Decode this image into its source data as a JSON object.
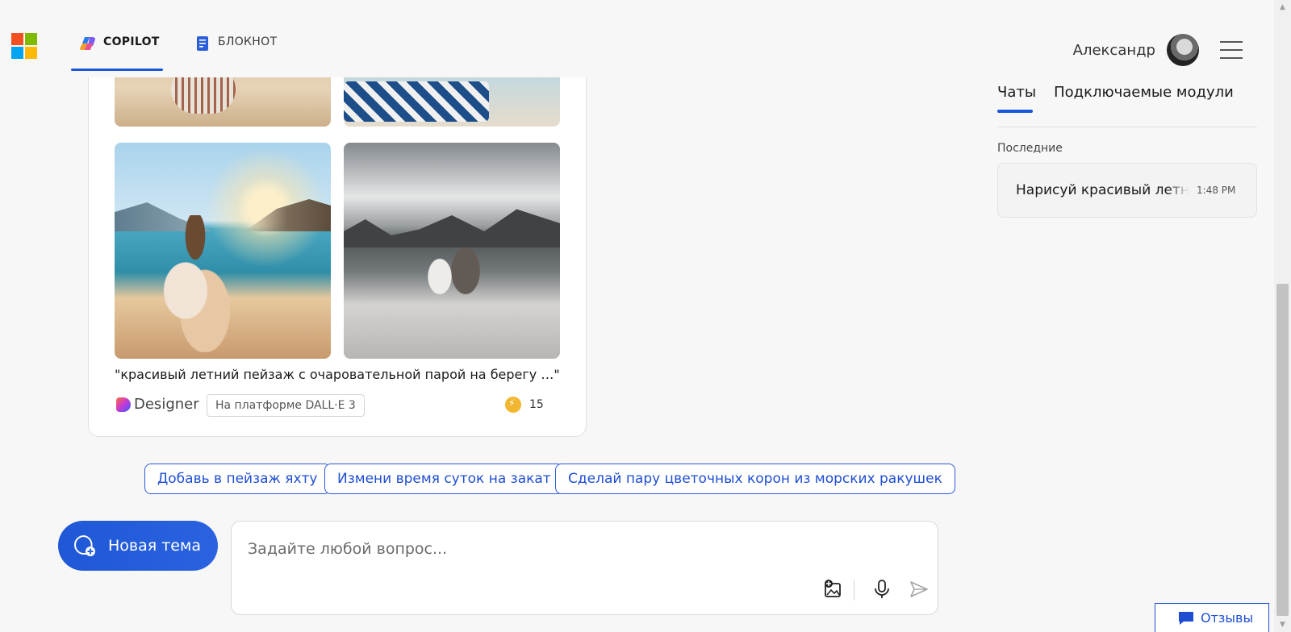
{
  "header": {
    "tabs": [
      {
        "label": "COPILOT",
        "icon": "copilot-icon",
        "active": true
      },
      {
        "label": "БЛОКНОТ",
        "icon": "notebook-icon",
        "active": false
      }
    ],
    "user_name": "Александр",
    "brand_colors": {
      "red": "#f25022",
      "green": "#7fba00",
      "blue": "#00a4ef",
      "yellow": "#ffb900"
    }
  },
  "result_card": {
    "caption": "\"красивый летний пейзаж с очаровательной парой на берегу …\"",
    "designer_label": "Designer",
    "platform_badge": "На платформе DALL·E 3",
    "boost_count": "15"
  },
  "suggestions": [
    "Добавь в пейзаж яхту",
    "Измени время суток на закат",
    "Сделай пару цветочных корон из морских ракушек"
  ],
  "composer": {
    "new_topic_label": "Новая тема",
    "placeholder": "Задайте любой вопрос..."
  },
  "sidebar": {
    "tabs": [
      "Чаты",
      "Подключаемые модули"
    ],
    "section_label": "Последние",
    "recent_chats": [
      {
        "title": "Нарисуй красивый летний пейзаж",
        "time": "1:48 PM"
      }
    ]
  },
  "feedback_label": "Отзывы",
  "accent_color": "#1a56db"
}
